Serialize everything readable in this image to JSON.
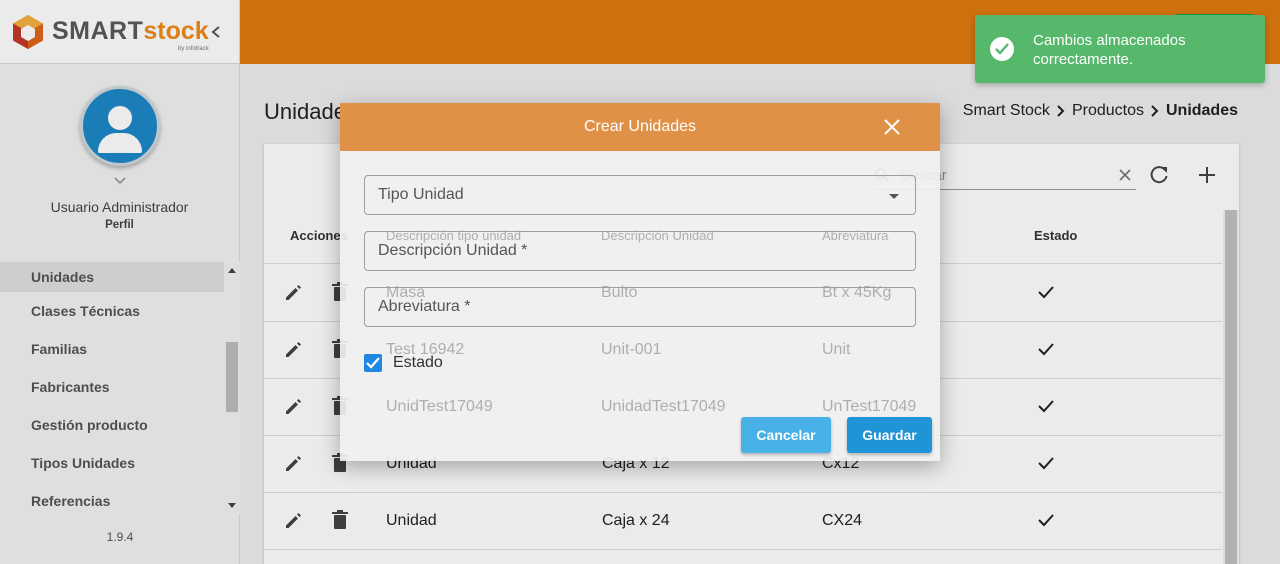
{
  "brand": {
    "name_part1": "SMART",
    "name_part2": "stock",
    "byline": "by infotrack"
  },
  "sidebar": {
    "user_name": "Usuario Administrador",
    "user_role": "Perfil",
    "items": [
      {
        "label": "Unidades",
        "active": true
      },
      {
        "label": "Clases Técnicas"
      },
      {
        "label": "Familias"
      },
      {
        "label": "Fabricantes"
      },
      {
        "label": "Gestión producto"
      },
      {
        "label": "Tipos Unidades"
      },
      {
        "label": "Referencias"
      }
    ],
    "version": "1.9.4"
  },
  "page": {
    "title": "Unidades",
    "breadcrumb": [
      "Smart Stock",
      "Productos",
      "Unidades"
    ]
  },
  "toolbar": {
    "search_placeholder": "Buscar"
  },
  "table": {
    "headers": {
      "actions": "Acciones",
      "type_desc": "Descripción tipo unidad",
      "unit_desc": "Descripción Unidad",
      "abbr": "Abreviatura",
      "status": "Estado"
    },
    "rows": [
      {
        "type_desc": "Masa",
        "unit_desc": "Bulto",
        "abbr": "Bt x 45Kg",
        "active": true
      },
      {
        "type_desc": "Test 16942",
        "unit_desc": "Unit-001",
        "abbr": "Unit",
        "active": true
      },
      {
        "type_desc": "UnidTest17049",
        "unit_desc": "UnidadTest17049",
        "abbr": "UnTest17049",
        "active": true
      },
      {
        "type_desc": "Unidad",
        "unit_desc": "Caja x 12",
        "abbr": "Cx12",
        "active": true
      },
      {
        "type_desc": "Unidad",
        "unit_desc": "Caja x 24",
        "abbr": "CX24",
        "active": true
      }
    ]
  },
  "modal": {
    "title": "Crear Unidades",
    "fields": {
      "tipo_unidad": "Tipo Unidad",
      "descripcion": "Descripción Unidad *",
      "abreviatura": "Abreviatura *"
    },
    "estado_label": "Estado",
    "estado_checked": true,
    "cancel_label": "Cancelar",
    "save_label": "Guardar"
  },
  "toast": {
    "message_line1": "Cambios almacenados",
    "message_line2": "correctamente."
  },
  "colors": {
    "header": "#e07a10",
    "modal_header": "#e09148",
    "primary": "#1f94d6",
    "success": "#55b86a"
  }
}
